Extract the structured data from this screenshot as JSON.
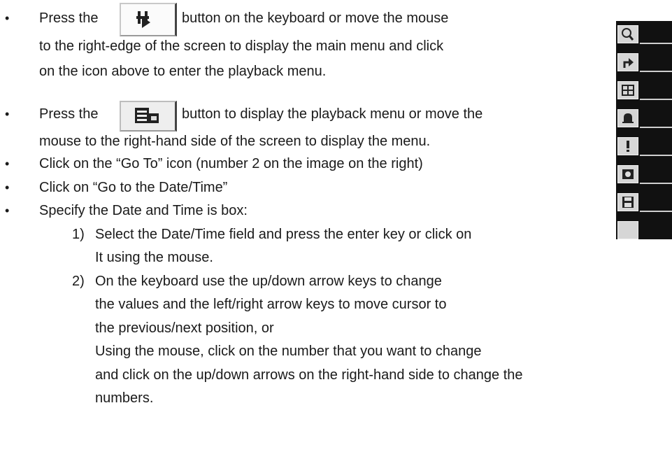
{
  "items": [
    {
      "prefix": "Press the",
      "suffix": "button on the keyboard or move the mouse",
      "cont": [
        "to the right-edge of the screen to display the main menu and click",
        "on the icon above to enter the playback menu."
      ]
    },
    {
      "prefix": "Press the",
      "suffix": "button to display the playback menu or move the",
      "cont": [
        "mouse to the right-hand side of the screen to display the menu."
      ]
    },
    {
      "text": "Click on the “Go To” icon (number 2 on the image on the right)"
    },
    {
      "text": "Click on “Go to the Date/Time”"
    },
    {
      "text": "Specify the Date and Time is box:"
    }
  ],
  "steps": [
    {
      "num": "1)",
      "lines": [
        "Select the Date/Time field and press the enter key or click on",
        "It using the mouse."
      ]
    },
    {
      "num": "2)",
      "lines": [
        "On the keyboard use the up/down arrow keys to change",
        "the values and the left/right arrow keys to move cursor to",
        "the previous/next position, or",
        "Using the mouse, click on the number that you want to change",
        "and click on the up/down arrows on the right-hand side to change the",
        "numbers."
      ]
    }
  ],
  "bullet_char": "•",
  "icons": {
    "play_button": "film-play-icon",
    "playback_button": "playback-menu-icon",
    "side_menu": [
      "search-icon",
      "goto-arrow-icon",
      "grid-icon",
      "bell-icon",
      "alert-icon",
      "record-icon",
      "save-icon"
    ]
  }
}
